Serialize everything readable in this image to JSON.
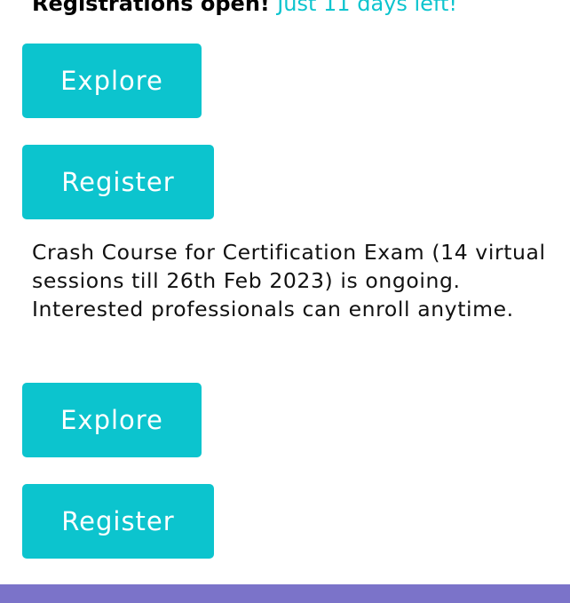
{
  "headline": {
    "prefix": "Registrations open!",
    "accent": "Just 11 days left!"
  },
  "section1": {
    "explore_label": "Explore",
    "register_label": "Register"
  },
  "course": {
    "description": "Crash Course for Certification Exam (14 virtual sessions till 26th Feb 2023) is ongoing. Interested professionals can enroll anytime."
  },
  "section2": {
    "explore_label": "Explore",
    "register_label": "Register"
  },
  "colors": {
    "accent": "#0cc4ce",
    "footer": "#7b73c9"
  }
}
